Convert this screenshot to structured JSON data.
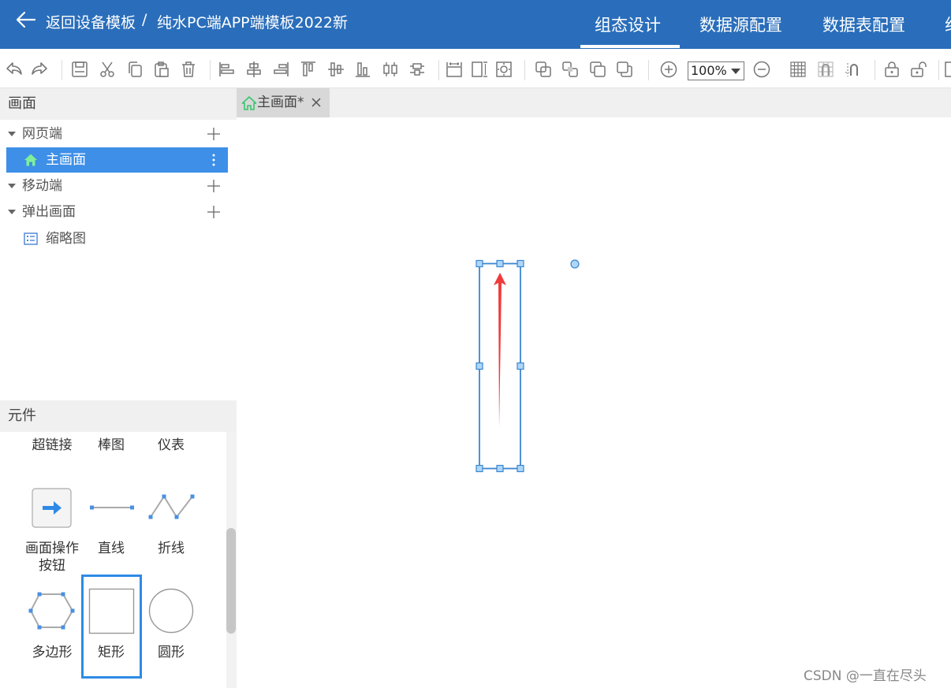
{
  "header": {
    "back_label": "返回设备模板",
    "separator": "/",
    "template_name": "纯水PC端APP端模板2022新",
    "tabs": [
      {
        "label": "组态设计",
        "active": true
      },
      {
        "label": "数据源配置",
        "active": false
      },
      {
        "label": "数据表配置",
        "active": false
      },
      {
        "label": "组",
        "active": false
      }
    ],
    "bg_color": "#2a6ebb"
  },
  "toolbar": {
    "zoom": "100%",
    "icons": [
      "undo-icon",
      "redo-icon",
      "save-icon",
      "cut-icon",
      "copy-icon",
      "paste-icon",
      "delete-icon",
      "align-left-icon",
      "align-center-icon",
      "align-right-icon",
      "align-top-icon",
      "align-middle-icon",
      "align-bottom-icon",
      "distribute-horizontal-icon",
      "distribute-vertical-icon",
      "same-width-icon",
      "same-height-icon",
      "same-size-icon",
      "bring-forward-icon",
      "send-backward-icon",
      "bring-to-front-icon",
      "send-to-back-icon",
      "zoom-in-icon",
      "zoom-out-icon",
      "grid-icon",
      "snap-grid-icon",
      "snap-icon",
      "lock-icon",
      "unlock-icon"
    ]
  },
  "screens_panel": {
    "title": "画面",
    "web_group": "网页端",
    "main_screen": "主画面",
    "mobile_group": "移动端",
    "popup_group": "弹出画面",
    "thumbnail": "缩略图",
    "selected_color": "#3d8fe8"
  },
  "components_panel": {
    "title": "元件",
    "items": [
      {
        "label": "超链接"
      },
      {
        "label": "棒图"
      },
      {
        "label": "仪表"
      },
      {
        "label": "画面操作按钮",
        "icon": "arrow-button-icon"
      },
      {
        "label": "直线",
        "icon": "line-icon"
      },
      {
        "label": "折线",
        "icon": "polyline-icon"
      },
      {
        "label": "多边形",
        "icon": "polygon-icon"
      },
      {
        "label": "矩形",
        "icon": "rectangle-icon",
        "selected": true
      },
      {
        "label": "圆形",
        "icon": "circle-icon"
      }
    ]
  },
  "canvas": {
    "tab_label": "主画面*",
    "selection_color": "#3a86d1",
    "arrow_color": "#f03a3a"
  },
  "watermark": "CSDN @一直在尽头"
}
